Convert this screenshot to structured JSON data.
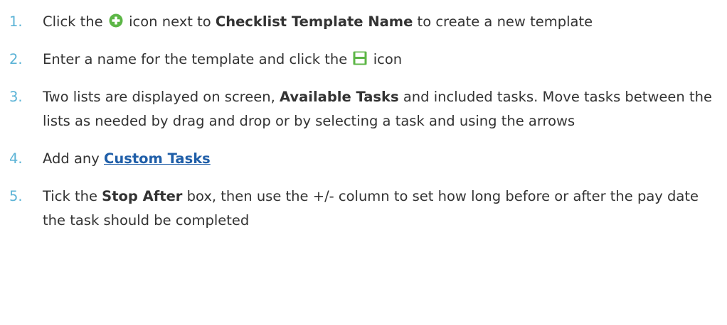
{
  "steps": [
    {
      "number": "1.",
      "text_a": "Click the",
      "icon": "plus-circle-icon",
      "text_b": "icon next to",
      "bold": "Checklist Template Name",
      "text_c": "to create a new template"
    },
    {
      "number": "2.",
      "text_a": "Enter a name for the template and click the",
      "icon": "save-icon",
      "text_b": "icon"
    },
    {
      "number": "3.",
      "text_a": "Two lists are displayed on screen,",
      "bold": "Available Tasks",
      "text_b": "and included tasks. Move tasks between the lists as needed by drag and drop or by selecting a task and using the arrows"
    },
    {
      "number": "4.",
      "text_a": "Add any",
      "link": "Custom Tasks"
    },
    {
      "number": "5.",
      "text_a": "Tick the",
      "bold": "Stop After",
      "text_b": "box, then use the +/- column to set how long before or after the pay date the task should be completed"
    }
  ],
  "colors": {
    "step_number": "#5bb3d6",
    "body_text": "#333333",
    "link": "#1f5ea8",
    "plus_icon": "#5cb646",
    "save_icon": "#5cb646"
  }
}
